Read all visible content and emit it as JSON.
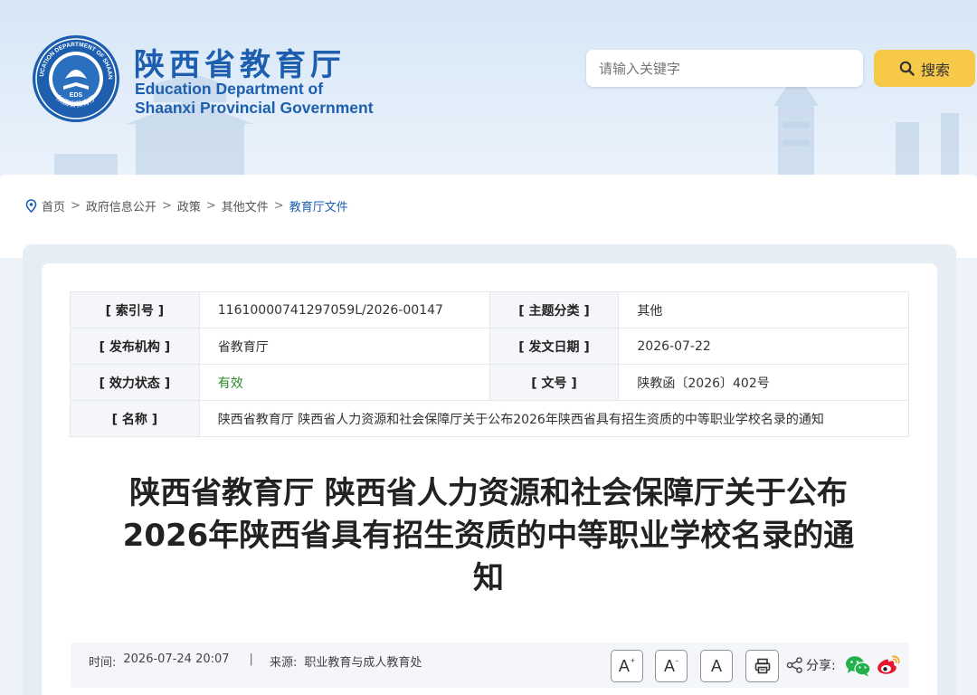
{
  "header": {
    "emblem_text": "EDUCATION DEPARTMENT OF SHAANXI",
    "emblem_cn": "陕西省教育厅",
    "emblem_abbr": "EDS",
    "title_cn": "陕西省教育厅",
    "title_en_line1": "Education Department of",
    "title_en_line2": "Shaanxi Provincial Government"
  },
  "search": {
    "placeholder": "请输入关键字",
    "button_label": "搜索"
  },
  "breadcrumb": {
    "items": [
      "首页",
      "政府信息公开",
      "政策",
      "其他文件",
      "教育厅文件"
    ],
    "separator": ">"
  },
  "meta": {
    "index_key": "[ 索引号 ]",
    "index_val": "11610000741297059L/2026-00147",
    "category_key": "[ 主题分类 ]",
    "category_val": "其他",
    "publisher_key": "[ 发布机构 ]",
    "publisher_val": "省教育厅",
    "date_key": "[ 发文日期 ]",
    "date_val": "2026-07-22",
    "status_key": "[ 效力状态 ]",
    "status_val": "有效",
    "docno_key": "[ 文号 ]",
    "docno_val": "陕教函〔2026〕402号",
    "name_key": "[ 名称 ]",
    "name_val": "陕西省教育厅 陕西省人力资源和社会保障厅关于公布2026年陕西省具有招生资质的中等职业学校名录的通知"
  },
  "article": {
    "title_line1": "陕西省教育厅 陕西省人力资源和社会保障厅关于公布",
    "title_line2": "2026年陕西省具有招生资质的中等职业学校名录的通",
    "title_line3": "知"
  },
  "infobar": {
    "time_label": "时间:",
    "time_value": "2026-07-24 20:07",
    "divider": "|",
    "source_label": "来源:",
    "source_value": "职业教育与成人教育处",
    "font_large": "A",
    "font_large_sup": "+",
    "font_small": "A",
    "font_small_sup": "-",
    "font_normal": "A",
    "share_label": "分享:"
  },
  "colors": {
    "brand_blue": "#1d5fae",
    "search_button": "#f7c948",
    "valid_green": "#2b8a2b",
    "wechat_green": "#22b14c",
    "weibo_red": "#e6162d"
  }
}
